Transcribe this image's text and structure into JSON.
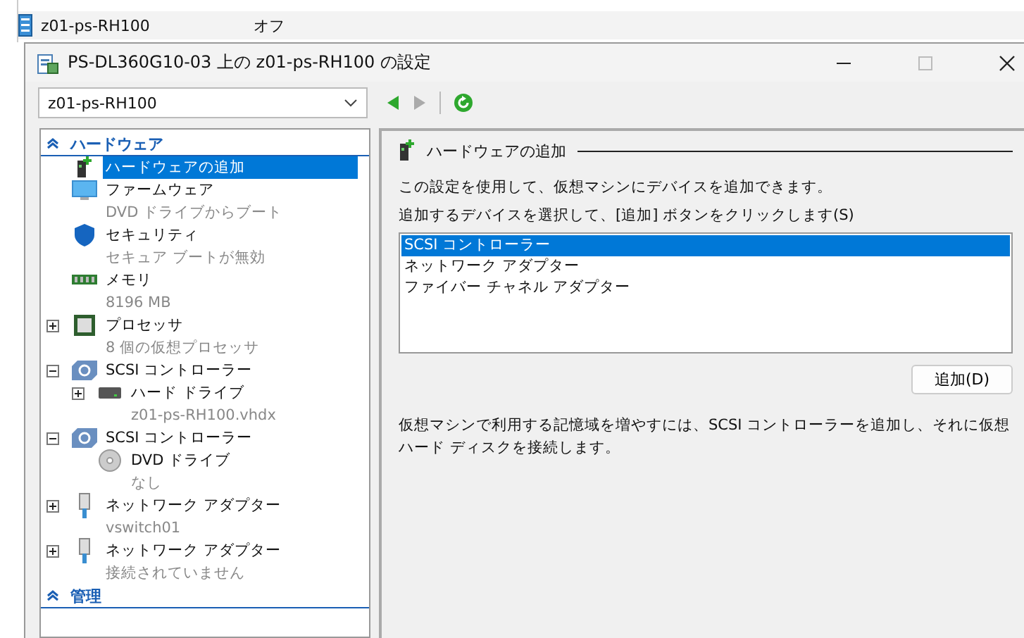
{
  "background_list": {
    "rows": [
      {
        "name": "z01-ps-RH100",
        "state": "オフ"
      }
    ]
  },
  "window": {
    "title": "PS-DL360G10-03 上の z01-ps-RH100 の設定"
  },
  "toolbar": {
    "vm_select": {
      "value": "z01-ps-RH100"
    }
  },
  "sidebar": {
    "sections": [
      {
        "title": "ハードウェア",
        "expanded": true,
        "items": [
          {
            "kind": "add-hardware",
            "label": "ハードウェアの追加",
            "selected": true
          },
          {
            "kind": "firmware",
            "label": "ファームウェア",
            "detail": "DVD ドライブからブート",
            "selected": false
          },
          {
            "kind": "security",
            "label": "セキュリティ",
            "detail": "セキュア ブートが無効",
            "selected": false
          },
          {
            "kind": "memory",
            "label": "メモリ",
            "detail": "8196 MB",
            "selected": false
          },
          {
            "kind": "processor",
            "label": "プロセッサ",
            "detail": "8 個の仮想プロセッサ",
            "selected": false,
            "expanded": false
          },
          {
            "kind": "scsi",
            "label": "SCSI コントローラー",
            "selected": false,
            "expanded": true,
            "children": [
              {
                "kind": "disk",
                "label": "ハード ドライブ",
                "detail": "z01-ps-RH100.vhdx",
                "selected": false,
                "expanded": false
              }
            ]
          },
          {
            "kind": "scsi",
            "label": "SCSI コントローラー",
            "selected": false,
            "expanded": true,
            "children": [
              {
                "kind": "dvd",
                "label": "DVD ドライブ",
                "detail": "なし",
                "selected": false
              }
            ]
          },
          {
            "kind": "network",
            "label": "ネットワーク アダプター",
            "detail": "vswitch01",
            "selected": false,
            "expanded": false
          },
          {
            "kind": "network",
            "label": "ネットワーク アダプター",
            "detail": "接続されていません",
            "selected": false,
            "expanded": false
          }
        ]
      },
      {
        "title": "管理",
        "expanded": true
      }
    ]
  },
  "panel": {
    "title": "ハードウェアの追加",
    "description": "この設定を使用して、仮想マシンにデバイスを追加できます。",
    "prompt": "追加するデバイスを選択して、[追加] ボタンをクリックします(S)",
    "devices": [
      {
        "label": "SCSI コントローラー",
        "selected": true
      },
      {
        "label": "ネットワーク アダプター",
        "selected": false
      },
      {
        "label": "ファイバー チャネル アダプター",
        "selected": false
      }
    ],
    "add_button": "追加(D)",
    "note": "仮想マシンで利用する記憶域を増やすには、SCSI コントローラーを追加し、それに仮想ハード ディスクを接続します。"
  }
}
